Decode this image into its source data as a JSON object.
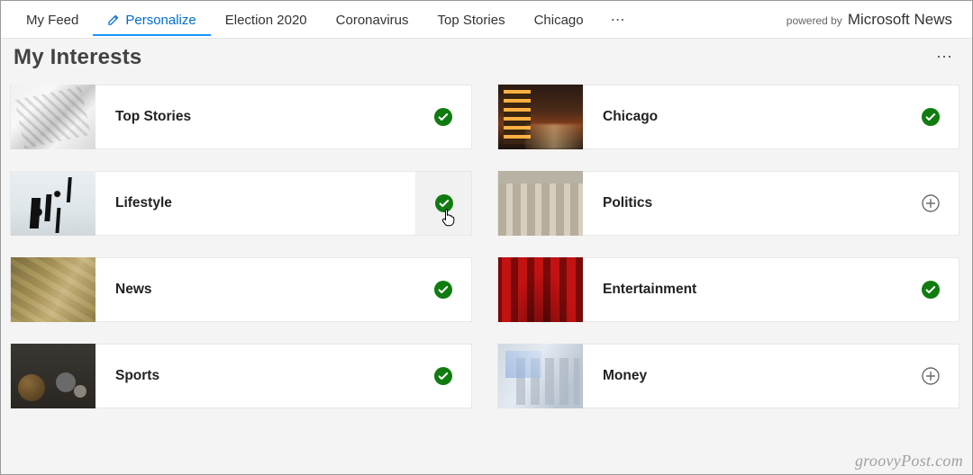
{
  "nav": {
    "tabs": [
      {
        "label": "My Feed",
        "active": false
      },
      {
        "label": "Personalize",
        "active": true,
        "icon": "pencil"
      },
      {
        "label": "Election 2020",
        "active": false
      },
      {
        "label": "Coronavirus",
        "active": false
      },
      {
        "label": "Top Stories",
        "active": false
      },
      {
        "label": "Chicago",
        "active": false
      }
    ],
    "more_glyph": "⋯",
    "powered_prefix": "powered by",
    "powered_brand": "Microsoft News"
  },
  "header": {
    "title": "My Interests",
    "more_glyph": "⋯"
  },
  "interests": [
    {
      "label": "Top Stories",
      "thumb": "newspaper",
      "selected": true,
      "hovered": false
    },
    {
      "label": "Chicago",
      "thumb": "chicago",
      "selected": true,
      "hovered": false
    },
    {
      "label": "Lifestyle",
      "thumb": "lifestyle",
      "selected": true,
      "hovered": true
    },
    {
      "label": "Politics",
      "thumb": "politics",
      "selected": false,
      "hovered": false
    },
    {
      "label": "News",
      "thumb": "news",
      "selected": true,
      "hovered": false
    },
    {
      "label": "Entertainment",
      "thumb": "entertainment",
      "selected": true,
      "hovered": false
    },
    {
      "label": "Sports",
      "thumb": "sports",
      "selected": true,
      "hovered": false
    },
    {
      "label": "Money",
      "thumb": "money",
      "selected": false,
      "hovered": false
    }
  ],
  "colors": {
    "check_green": "#107c10",
    "accent_blue": "#1b95ff"
  },
  "watermark": "groovyPost.com"
}
